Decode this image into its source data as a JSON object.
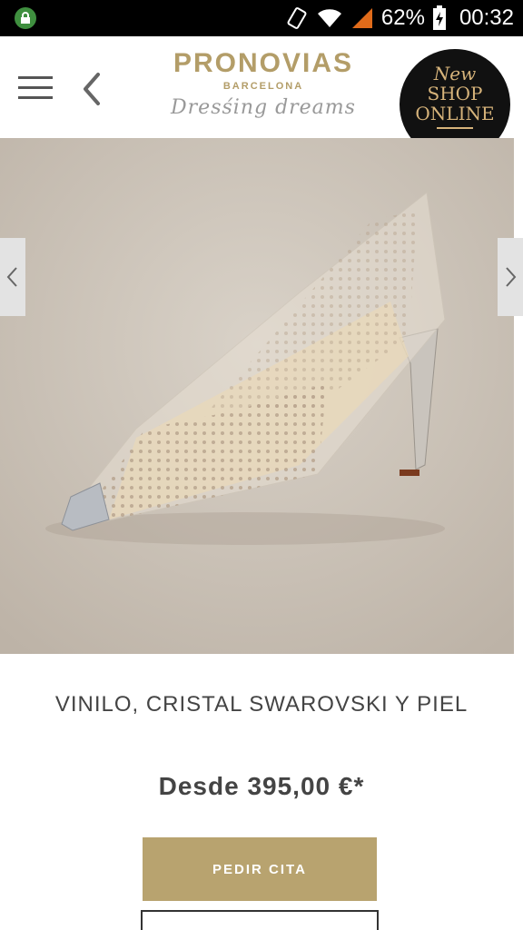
{
  "status_bar": {
    "battery_percent": "62%",
    "time": "00:32",
    "icons": [
      "lock-icon",
      "vibrate-icon",
      "wifi-icon",
      "signal-icon",
      "battery-charging-icon"
    ]
  },
  "header": {
    "brand_name": "PRONOVIAS",
    "brand_city": "BARCELONA",
    "brand_tagline": "Dresśing dreams",
    "badge_line1": "New",
    "badge_line2": "SHOP",
    "badge_line3": "ONLINE"
  },
  "product": {
    "material": "VINILO, CRISTAL SWAROVSKI Y PIEL",
    "price": "Desde 395,00 €*",
    "cta_label": "PEDIR CITA"
  },
  "colors": {
    "brand_gold": "#b39d68",
    "button_gold": "#b8a36f",
    "text_dark": "#444444"
  }
}
